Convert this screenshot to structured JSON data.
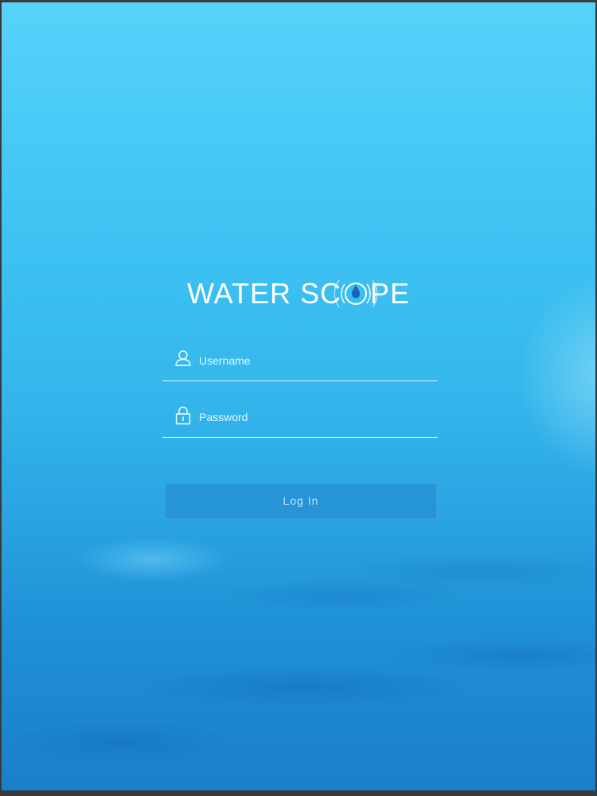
{
  "brand": {
    "name_part1": "WATER SC",
    "name_part2": "PE",
    "logo_icon": "water-drop-ripple-icon"
  },
  "login_form": {
    "username": {
      "placeholder": "Username",
      "value": "",
      "icon": "user-icon"
    },
    "password": {
      "placeholder": "Password",
      "value": "",
      "icon": "lock-icon"
    },
    "submit_label": "Log In"
  },
  "colors": {
    "background_top": "#57d3fb",
    "background_bottom": "#1a7fca",
    "text": "#ffffff",
    "button_bg": "#2387cd"
  }
}
